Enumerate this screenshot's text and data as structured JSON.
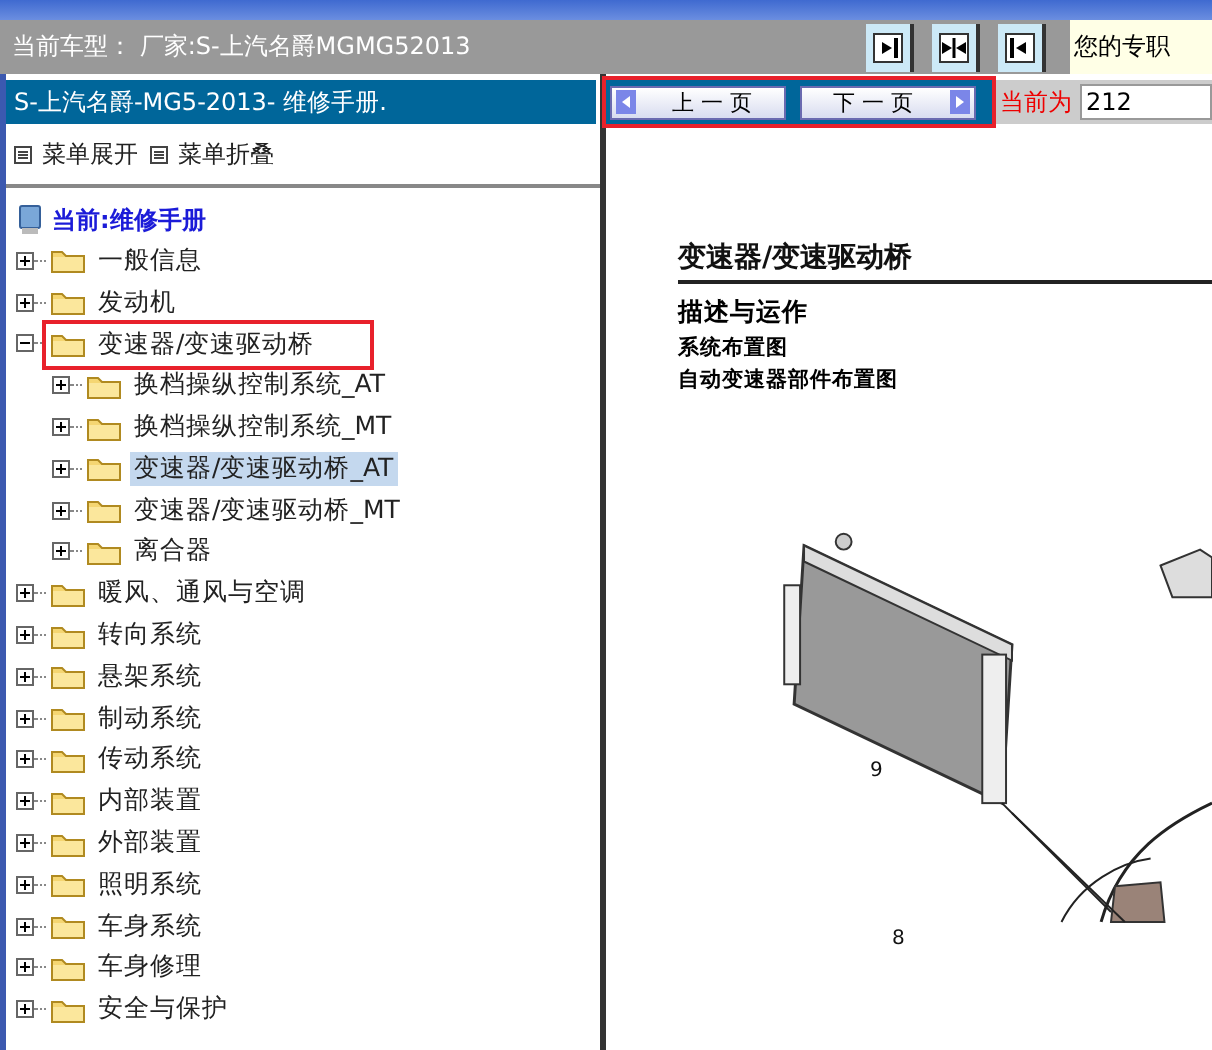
{
  "top_bar": {
    "model_label": "当前车型： 厂家:S-上汽名爵MGMG52013",
    "notice": "您的专职"
  },
  "left_panel": {
    "title": "S-上汽名爵-MG5-2013- 维修手册.",
    "menu_actions": [
      {
        "label": "菜单展开"
      },
      {
        "label": "菜单折叠"
      }
    ],
    "tree_root": "当前:维修手册",
    "tree": [
      {
        "label": "一般信息",
        "expanded": false,
        "selected": false,
        "highlighted": false
      },
      {
        "label": "发动机",
        "expanded": false,
        "selected": false,
        "highlighted": false
      },
      {
        "label": "变速器/变速驱动桥",
        "expanded": true,
        "selected": false,
        "highlighted": true,
        "children": [
          {
            "label": "换档操纵控制系统_AT",
            "expanded": false,
            "selected": false,
            "highlighted": false
          },
          {
            "label": "换档操纵控制系统_MT",
            "expanded": false,
            "selected": false,
            "highlighted": false
          },
          {
            "label": "变速器/变速驱动桥_AT",
            "expanded": false,
            "selected": true,
            "highlighted": false
          },
          {
            "label": "变速器/变速驱动桥_MT",
            "expanded": false,
            "selected": false,
            "highlighted": false
          },
          {
            "label": "离合器",
            "expanded": false,
            "selected": false,
            "highlighted": false
          }
        ]
      },
      {
        "label": "暖风、通风与空调",
        "expanded": false,
        "selected": false,
        "highlighted": false
      },
      {
        "label": "转向系统",
        "expanded": false,
        "selected": false,
        "highlighted": false
      },
      {
        "label": "悬架系统",
        "expanded": false,
        "selected": false,
        "highlighted": false
      },
      {
        "label": "制动系统",
        "expanded": false,
        "selected": false,
        "highlighted": false
      },
      {
        "label": "传动系统",
        "expanded": false,
        "selected": false,
        "highlighted": false
      },
      {
        "label": "内部装置",
        "expanded": false,
        "selected": false,
        "highlighted": false
      },
      {
        "label": "外部装置",
        "expanded": false,
        "selected": false,
        "highlighted": false
      },
      {
        "label": "照明系统",
        "expanded": false,
        "selected": false,
        "highlighted": false
      },
      {
        "label": "车身系统",
        "expanded": false,
        "selected": false,
        "highlighted": false
      },
      {
        "label": "车身修理",
        "expanded": false,
        "selected": false,
        "highlighted": false
      },
      {
        "label": "安全与保护",
        "expanded": false,
        "selected": false,
        "highlighted": false
      }
    ]
  },
  "viewer": {
    "nav_highlighted": true,
    "prev_button": "上 一 页",
    "next_button": "下 一 页",
    "page_label": "当前为",
    "page_value": "212",
    "document": {
      "title": "变速器/变速驱动桥",
      "heading": "描述与运作",
      "lines": [
        "系统布置图",
        "自动变速器部件布置图"
      ],
      "callouts": [
        "9",
        "8"
      ]
    }
  }
}
